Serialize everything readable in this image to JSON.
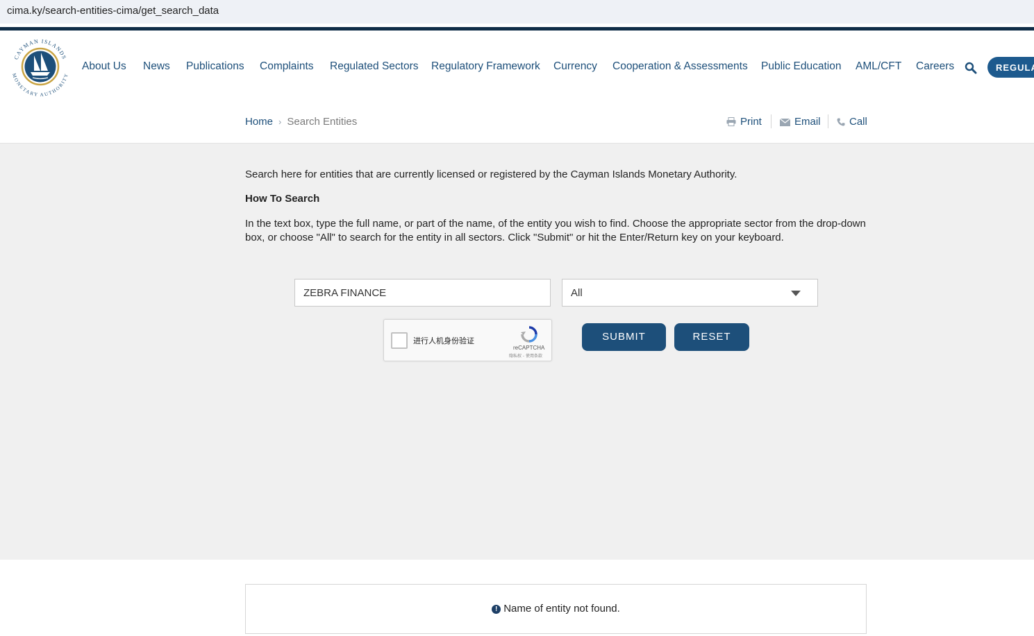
{
  "browser": {
    "url": "cima.ky/search-entities-cima/get_search_data"
  },
  "logo": {
    "text_top": "CAYMAN ISLANDS",
    "text_bottom": "MONETARY AUTHORITY"
  },
  "nav": {
    "items": [
      {
        "label": "About Us"
      },
      {
        "label": "News"
      },
      {
        "label": "Publications"
      },
      {
        "label": "Complaints"
      },
      {
        "label": "Regulated Sectors"
      },
      {
        "label": "Regulatory Framework"
      },
      {
        "label": "Currency"
      },
      {
        "label": "Cooperation & Assessments"
      },
      {
        "label": "Public Education"
      },
      {
        "label": "AML/CFT"
      },
      {
        "label": "Careers"
      }
    ],
    "cta_label": "REGULAT"
  },
  "breadcrumb": {
    "home": "Home",
    "separator": "›",
    "current": "Search Entities"
  },
  "tools": {
    "print": "Print",
    "email": "Email",
    "call": "Call"
  },
  "content": {
    "intro": "Search here for entities that are currently licensed or registered by the Cayman Islands Monetary Authority.",
    "how_to_title": "How To Search",
    "instructions": "In the text box, type the full name, or part of the name, of the entity you wish to find. Choose the appropriate sector from the drop-down box, or choose \"All\" to search for the entity in all sectors. Click \"Submit\" or hit the Enter/Return key on your keyboard."
  },
  "search": {
    "name_value": "ZEBRA FINANCE",
    "sector_selected": "All",
    "submit_label": "SUBMIT",
    "reset_label": "RESET"
  },
  "captcha": {
    "label": "进行人机身份验证",
    "brand": "reCAPTCHA",
    "terms": "隐私权 - 使用条款"
  },
  "result": {
    "message": "Name of entity not found."
  },
  "colors": {
    "brand_navy": "#1d4f7a",
    "top_bar": "#0f2d47",
    "grey_bg": "#f0f0f0"
  }
}
